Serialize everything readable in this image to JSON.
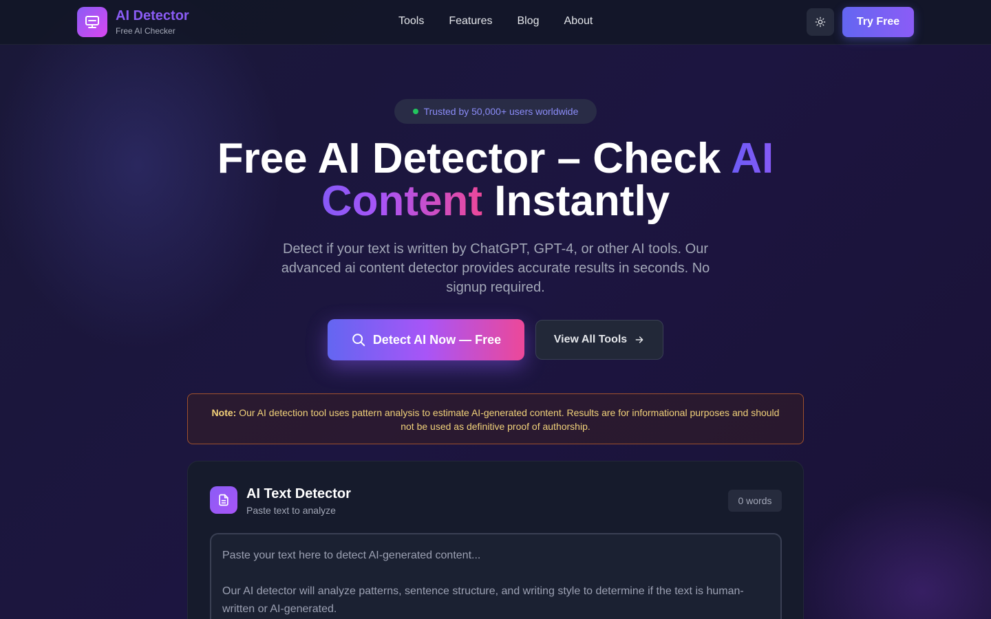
{
  "brand": {
    "title": "AI Detector",
    "subtitle": "Free AI Checker"
  },
  "nav": {
    "links": [
      "Tools",
      "Features",
      "Blog",
      "About"
    ],
    "try_label": "Try Free"
  },
  "hero": {
    "badge": "Trusted by 50,000+ users worldwide",
    "title_part1": "Free AI Detector – Check ",
    "title_highlight": "AI Content",
    "title_part2": " Instantly",
    "subtitle": "Detect if your text is written by ChatGPT, GPT-4, or other AI tools. Our advanced ai content detector provides accurate results in seconds. No signup required.",
    "cta_primary": "Detect AI Now — Free",
    "cta_secondary": "View All Tools"
  },
  "note": {
    "label": "Note:",
    "text": " Our AI detection tool uses pattern analysis to estimate AI-generated content. Results are for informational purposes and should not be used as definitive proof of authorship."
  },
  "detector": {
    "title": "AI Text Detector",
    "subtitle": "Paste text to analyze",
    "word_count": "0 words",
    "placeholder": "Paste your text here to detect AI-generated content...\n\nOur AI detector will analyze patterns, sentence structure, and writing style to determine if the text is human-written or AI-generated."
  },
  "colors": {
    "accent": "#8b5cf6",
    "pink": "#ec4899",
    "status_dot": "#22c55e"
  }
}
